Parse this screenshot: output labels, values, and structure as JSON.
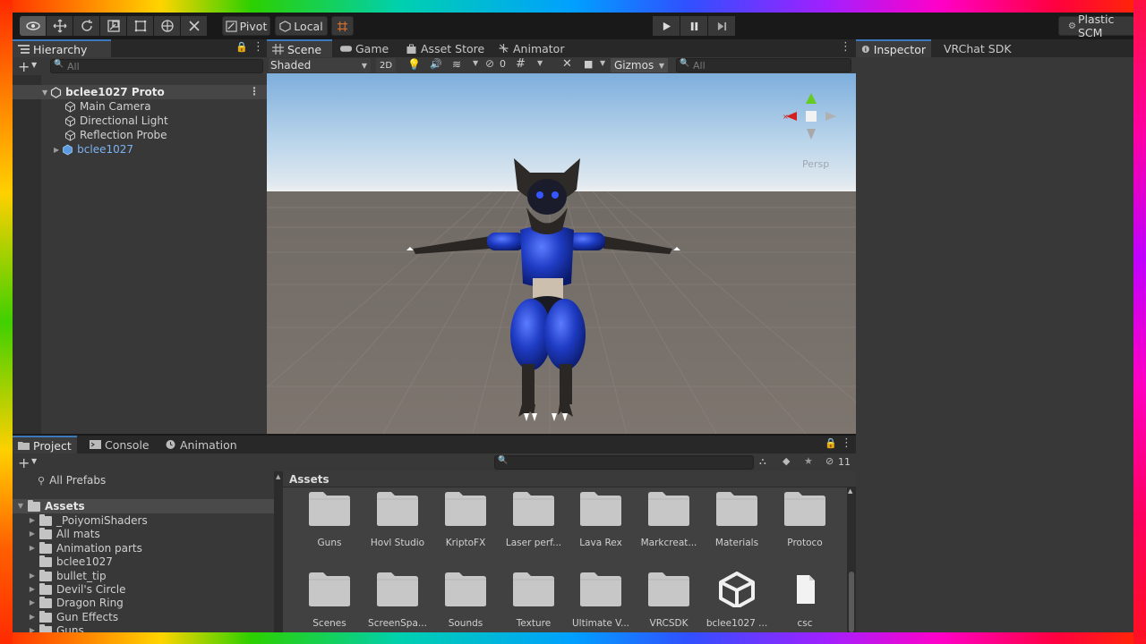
{
  "toolbar": {
    "pivot_label": "Pivot",
    "local_label": "Local",
    "plastic_label": "Plastic SCM"
  },
  "hierarchy": {
    "tab_label": "Hierarchy",
    "search_placeholder": "All",
    "scene_name": "bclee1027 Proto",
    "items": [
      "Main Camera",
      "Directional Light",
      "Reflection Probe",
      "bclee1027"
    ]
  },
  "scene_view": {
    "tabs": [
      "Scene",
      "Game",
      "Asset Store",
      "Animator"
    ],
    "shading_mode": "Shaded",
    "mode_2d": "2D",
    "hidden_count": "0",
    "gizmos_label": "Gizmos",
    "search_placeholder": "All",
    "persp_label": "Persp"
  },
  "inspector": {
    "tabs": [
      "Inspector",
      "VRChat SDK"
    ]
  },
  "project": {
    "tabs": [
      "Project",
      "Console",
      "Animation"
    ],
    "all_prefabs": "All Prefabs",
    "assets_root": "Assets",
    "tree": [
      "_PoiyomiShaders",
      "All mats",
      "Animation parts",
      "bclee1027",
      "bullet_tip",
      "Devil's Circle",
      "Dragon Ring",
      "Gun Effects",
      "Guns"
    ],
    "breadcrumb": "Assets",
    "hidden_count": "11",
    "assets_row1": [
      "Guns",
      "Hovl Studio",
      "KriptoFX",
      "Laser perf...",
      "Lava Rex",
      "Markcreat...",
      "Materials",
      "Protoco"
    ],
    "assets_row2": [
      "Scenes",
      "ScreenSpa...",
      "Sounds",
      "Texture",
      "Ultimate V...",
      "VRCSDK",
      "bclee1027 ...",
      "csc"
    ]
  },
  "colors": {
    "accent": "#3a79bb",
    "panel_bg": "#383838",
    "prefab_blue": "#7cb3f2"
  }
}
